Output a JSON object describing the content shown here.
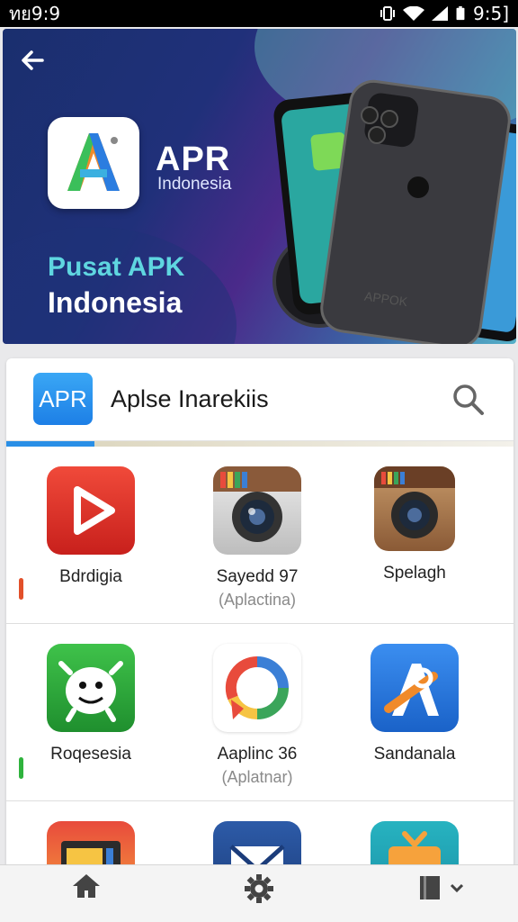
{
  "status_bar": {
    "left_text": "ทย9:9",
    "time": "9:5]"
  },
  "hero": {
    "brand_name": "APR",
    "brand_sub": "Indonesia",
    "title_line1": "Pusat APK",
    "title_line2": "Indonesia",
    "phone_label": "APPOK"
  },
  "search": {
    "badge": "APR",
    "title": "Aplse Inarekiis"
  },
  "apps": [
    {
      "name": "Bdrdigia",
      "sub": "",
      "icon": "play-icon",
      "mark_color": "#e2502a"
    },
    {
      "name": "Sayedd 97",
      "sub": "(Aplactina)",
      "icon": "camera-icon"
    },
    {
      "name": "Spelagh",
      "sub": "",
      "icon": "camera-icon"
    },
    {
      "name": "Roqesesia",
      "sub": "",
      "icon": "robot-icon",
      "mark_color": "#2fb33d"
    },
    {
      "name": "Aaplinc 36",
      "sub": "(Aplatnar)",
      "icon": "chat-ring-icon"
    },
    {
      "name": "Sandanala",
      "sub": "",
      "icon": "a-logo-icon"
    }
  ],
  "bottom_nav": [
    {
      "icon": "home-icon"
    },
    {
      "icon": "gear-icon"
    },
    {
      "icon": "book-icon"
    }
  ]
}
